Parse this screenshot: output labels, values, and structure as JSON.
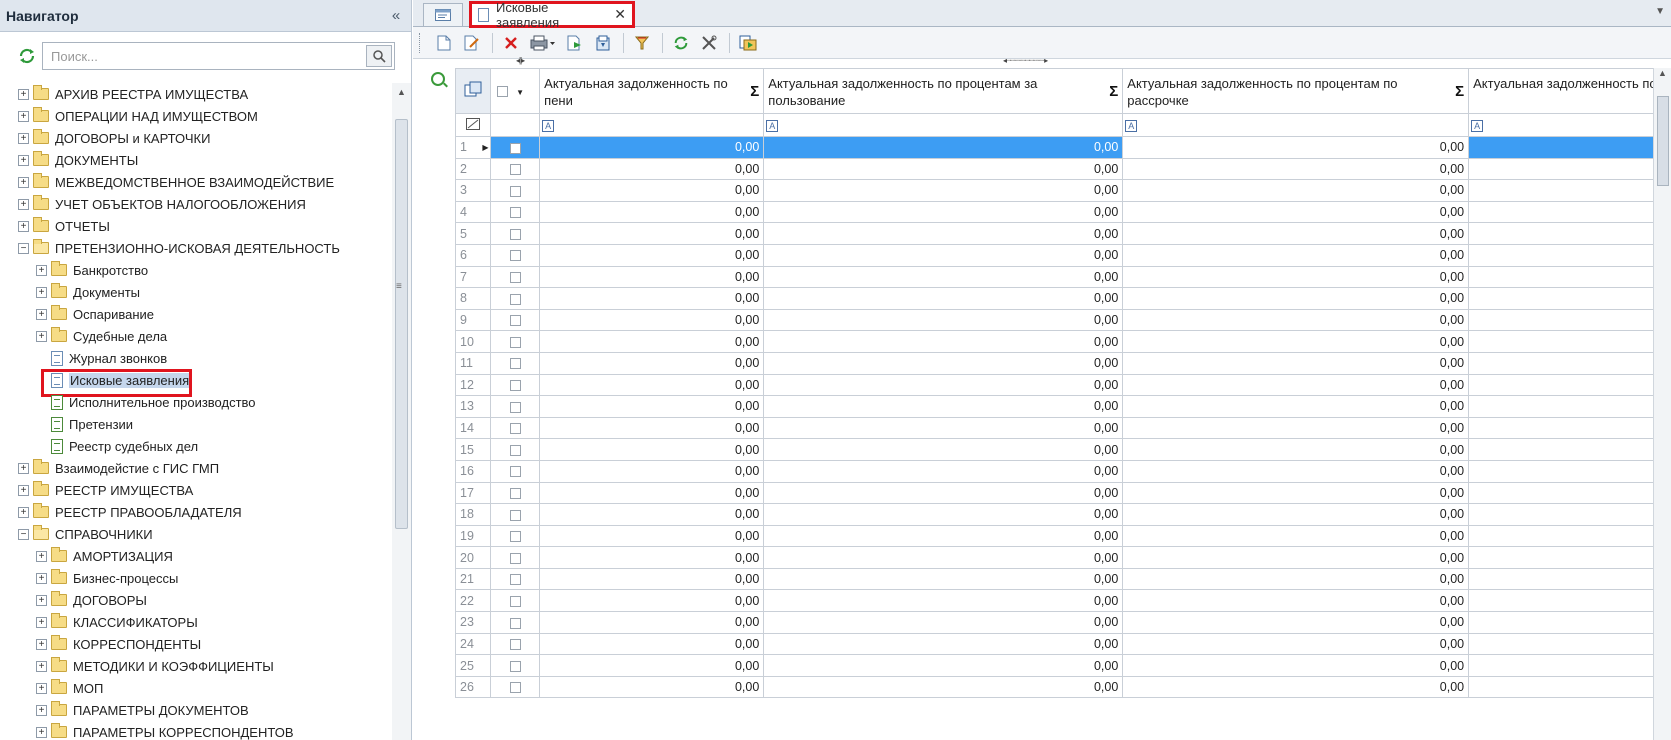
{
  "navigator": {
    "title": "Навигатор",
    "collapse_glyph": "«",
    "search_placeholder": "Поиск...",
    "tree": [
      {
        "level": 0,
        "label": "АРХИВ РЕЕСТРА ИМУЩЕСТВА",
        "kind": "folder",
        "expander": "+"
      },
      {
        "level": 0,
        "label": "ОПЕРАЦИИ НАД ИМУЩЕСТВОМ",
        "kind": "folder",
        "expander": "+"
      },
      {
        "level": 0,
        "label": "ДОГОВОРЫ и КАРТОЧКИ",
        "kind": "folder",
        "expander": "+"
      },
      {
        "level": 0,
        "label": "ДОКУМЕНТЫ",
        "kind": "folder",
        "expander": "+"
      },
      {
        "level": 0,
        "label": "МЕЖВЕДОМСТВЕННОЕ ВЗАИМОДЕЙСТВИЕ",
        "kind": "folder",
        "expander": "+"
      },
      {
        "level": 0,
        "label": "УЧЕТ ОБЪЕКТОВ НАЛОГООБЛОЖЕНИЯ",
        "kind": "folder",
        "expander": "+"
      },
      {
        "level": 0,
        "label": "ОТЧЕТЫ",
        "kind": "folder",
        "expander": "+"
      },
      {
        "level": 0,
        "label": "ПРЕТЕНЗИОННО-ИСКОВАЯ ДЕЯТЕЛЬНОСТЬ",
        "kind": "folder-open",
        "expander": "−"
      },
      {
        "level": 1,
        "label": "Банкротство",
        "kind": "folder",
        "expander": "+"
      },
      {
        "level": 1,
        "label": "Документы",
        "kind": "folder",
        "expander": "+"
      },
      {
        "level": 1,
        "label": "Оспаривание",
        "kind": "folder",
        "expander": "+"
      },
      {
        "level": 1,
        "label": "Судебные дела",
        "kind": "folder",
        "expander": "+"
      },
      {
        "level": 1,
        "label": "Журнал звонков",
        "kind": "doc",
        "expander": ""
      },
      {
        "level": 1,
        "label": "Исковые заявления",
        "kind": "doc",
        "expander": "",
        "selected": true
      },
      {
        "level": 1,
        "label": "Исполнительное производство",
        "kind": "doc-green",
        "expander": ""
      },
      {
        "level": 1,
        "label": "Претензии",
        "kind": "doc-green",
        "expander": ""
      },
      {
        "level": 1,
        "label": "Реестр судебных дел",
        "kind": "doc-green",
        "expander": ""
      },
      {
        "level": 0,
        "label": "Взаимодейстие с ГИС ГМП",
        "kind": "folder",
        "expander": "+"
      },
      {
        "level": 0,
        "label": "РЕЕСТР ИМУЩЕСТВА",
        "kind": "folder",
        "expander": "+"
      },
      {
        "level": 0,
        "label": "РЕЕСТР ПРАВООБЛАДАТЕЛЯ",
        "kind": "folder",
        "expander": "+"
      },
      {
        "level": 0,
        "label": "СПРАВОЧНИКИ",
        "kind": "folder-open",
        "expander": "−"
      },
      {
        "level": 1,
        "label": "АМОРТИЗАЦИЯ",
        "kind": "folder",
        "expander": "+"
      },
      {
        "level": 1,
        "label": "Бизнес-процессы",
        "kind": "folder",
        "expander": "+"
      },
      {
        "level": 1,
        "label": "ДОГОВОРЫ",
        "kind": "folder",
        "expander": "+"
      },
      {
        "level": 1,
        "label": "КЛАССИФИКАТОРЫ",
        "kind": "folder",
        "expander": "+"
      },
      {
        "level": 1,
        "label": "КОРРЕСПОНДЕНТЫ",
        "kind": "folder",
        "expander": "+"
      },
      {
        "level": 1,
        "label": "МЕТОДИКИ И КОЭФФИЦИЕНТЫ",
        "kind": "folder",
        "expander": "+"
      },
      {
        "level": 1,
        "label": "МОП",
        "kind": "folder",
        "expander": "+"
      },
      {
        "level": 1,
        "label": "ПАРАМЕТРЫ ДОКУМЕНТОВ",
        "kind": "folder",
        "expander": "+"
      },
      {
        "level": 1,
        "label": "ПАРАМЕТРЫ КОРРЕСПОНДЕНТОВ",
        "kind": "folder",
        "expander": "+"
      }
    ]
  },
  "tabs": {
    "active_label": "Исковые заявления",
    "close_glyph": "✕"
  },
  "toolbar": {
    "buttons": [
      "new-doc-icon",
      "edit-doc-icon",
      "delete-icon",
      "print-icon",
      "export-icon",
      "import-icon",
      "filter-icon",
      "refresh-icon",
      "settings-icon",
      "run-icon"
    ]
  },
  "grid": {
    "columns": [
      {
        "title": "Актуальная задолженность по пени",
        "sigma": "Σ"
      },
      {
        "title": "Актуальная задолженность по процентам за пользование",
        "sigma": "Σ"
      },
      {
        "title": "Актуальная задолженность по процентам по рассрочке",
        "sigma": "Σ"
      },
      {
        "title": "Актуальная задолженность по штрафам",
        "sigma": ""
      }
    ],
    "filter_glyph": "A",
    "rows": [
      {
        "n": "1",
        "v": [
          "0,00",
          "0,00",
          "0,00",
          ""
        ]
      },
      {
        "n": "2",
        "v": [
          "0,00",
          "0,00",
          "0,00",
          ""
        ]
      },
      {
        "n": "3",
        "v": [
          "0,00",
          "0,00",
          "0,00",
          ""
        ]
      },
      {
        "n": "4",
        "v": [
          "0,00",
          "0,00",
          "0,00",
          ""
        ]
      },
      {
        "n": "5",
        "v": [
          "0,00",
          "0,00",
          "0,00",
          ""
        ]
      },
      {
        "n": "6",
        "v": [
          "0,00",
          "0,00",
          "0,00",
          ""
        ]
      },
      {
        "n": "7",
        "v": [
          "0,00",
          "0,00",
          "0,00",
          ""
        ]
      },
      {
        "n": "8",
        "v": [
          "0,00",
          "0,00",
          "0,00",
          ""
        ]
      },
      {
        "n": "9",
        "v": [
          "0,00",
          "0,00",
          "0,00",
          ""
        ]
      },
      {
        "n": "10",
        "v": [
          "0,00",
          "0,00",
          "0,00",
          ""
        ]
      },
      {
        "n": "11",
        "v": [
          "0,00",
          "0,00",
          "0,00",
          ""
        ]
      },
      {
        "n": "12",
        "v": [
          "0,00",
          "0,00",
          "0,00",
          ""
        ]
      },
      {
        "n": "13",
        "v": [
          "0,00",
          "0,00",
          "0,00",
          ""
        ]
      },
      {
        "n": "14",
        "v": [
          "0,00",
          "0,00",
          "0,00",
          ""
        ]
      },
      {
        "n": "15",
        "v": [
          "0,00",
          "0,00",
          "0,00",
          ""
        ]
      },
      {
        "n": "16",
        "v": [
          "0,00",
          "0,00",
          "0,00",
          ""
        ]
      },
      {
        "n": "17",
        "v": [
          "0,00",
          "0,00",
          "0,00",
          ""
        ]
      },
      {
        "n": "18",
        "v": [
          "0,00",
          "0,00",
          "0,00",
          ""
        ]
      },
      {
        "n": "19",
        "v": [
          "0,00",
          "0,00",
          "0,00",
          ""
        ]
      },
      {
        "n": "20",
        "v": [
          "0,00",
          "0,00",
          "0,00",
          ""
        ]
      },
      {
        "n": "21",
        "v": [
          "0,00",
          "0,00",
          "0,00",
          ""
        ]
      },
      {
        "n": "22",
        "v": [
          "0,00",
          "0,00",
          "0,00",
          ""
        ]
      },
      {
        "n": "23",
        "v": [
          "0,00",
          "0,00",
          "0,00",
          ""
        ]
      },
      {
        "n": "24",
        "v": [
          "0,00",
          "0,00",
          "0,00",
          ""
        ]
      },
      {
        "n": "25",
        "v": [
          "0,00",
          "0,00",
          "0,00",
          ""
        ]
      },
      {
        "n": "26",
        "v": [
          "0,00",
          "0,00",
          "0,00",
          ""
        ]
      }
    ]
  },
  "colors": {
    "selection": "#3d9df3",
    "highlight_border": "#e0141e",
    "header_bg": "#dfe6ee"
  }
}
